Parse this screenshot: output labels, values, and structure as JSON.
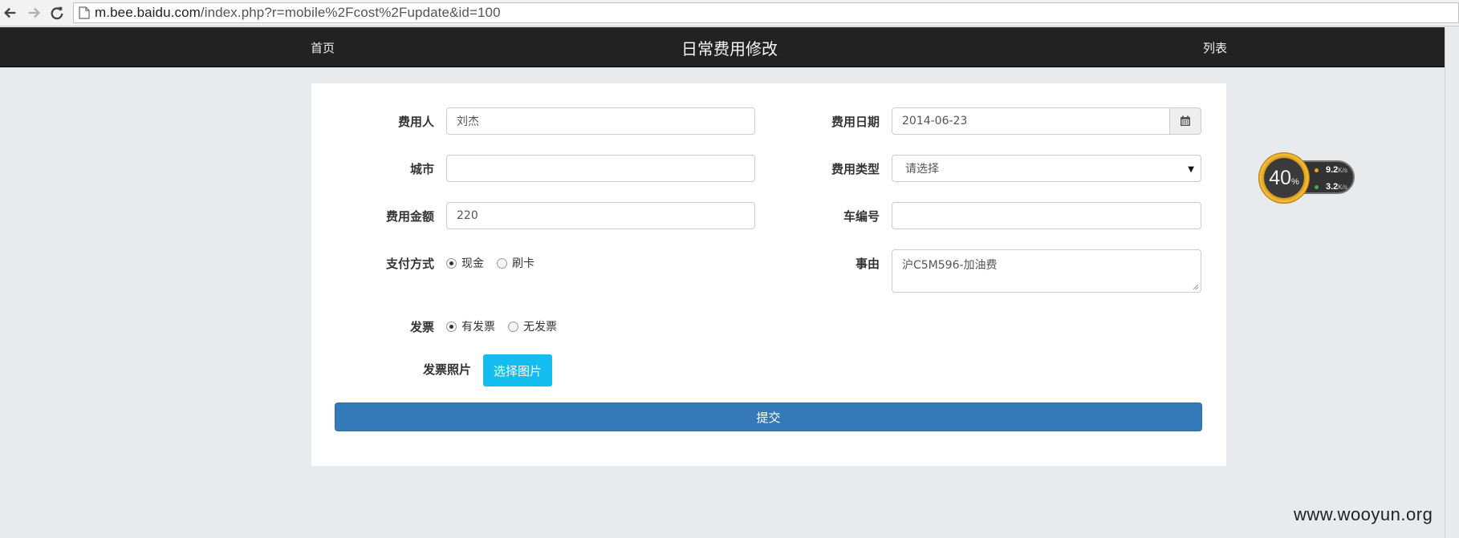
{
  "browser": {
    "url_host": "m.bee.baidu.com",
    "url_path": "/index.php?r=mobile%2Fcost%2Fupdate&id=100"
  },
  "navbar": {
    "home_label": "首页",
    "title": "日常费用修改",
    "list_label": "列表"
  },
  "form": {
    "payer": {
      "label": "费用人",
      "value": "刘杰"
    },
    "date": {
      "label": "费用日期",
      "value": "2014-06-23"
    },
    "city": {
      "label": "城市",
      "value": ""
    },
    "type": {
      "label": "费用类型",
      "selected": "请选择"
    },
    "amount": {
      "label": "费用金额",
      "value": "220"
    },
    "car_no": {
      "label": "车编号",
      "value": ""
    },
    "payment": {
      "label": "支付方式",
      "options": [
        "现金",
        "刷卡"
      ],
      "selected": "现金"
    },
    "reason": {
      "label": "事由",
      "value": "沪C5M596-加油费"
    },
    "invoice": {
      "label": "发票",
      "options": [
        "有发票",
        "无发票"
      ],
      "selected": "有发票"
    },
    "invoice_photo": {
      "label": "发票照片",
      "button": "选择图片"
    },
    "submit_label": "提交"
  },
  "widget": {
    "percent": "40",
    "percent_unit": "%",
    "up_value": "9.2",
    "down_value": "3.2",
    "speed_unit": "K/s"
  },
  "watermark": "www.wooyun.org",
  "colors": {
    "navbar": "#222222",
    "primary": "#337ab7",
    "file_button": "#14bdf0",
    "background": "#e8ebee"
  },
  "icons": [
    "back-arrow-icon",
    "forward-arrow-icon",
    "reload-icon",
    "page-icon",
    "calendar-icon",
    "caret-down-icon"
  ]
}
